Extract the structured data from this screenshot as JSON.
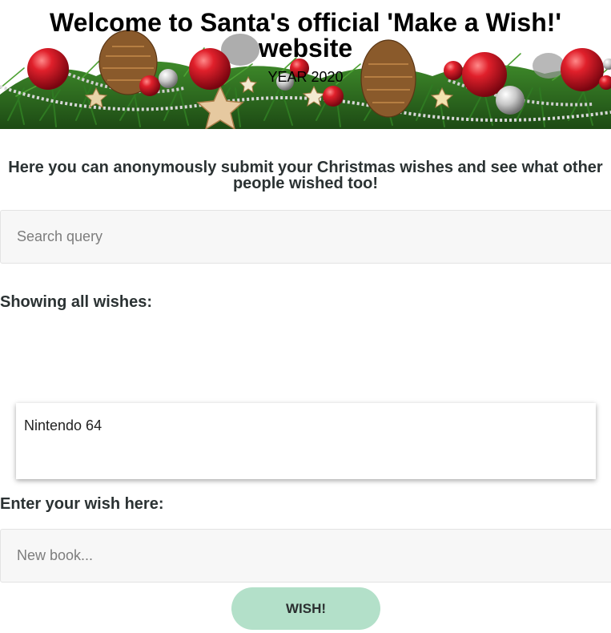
{
  "header": {
    "title": "Welcome to Santa's official 'Make a Wish!' website",
    "subtitle": "YEAR 2020"
  },
  "intro": {
    "text": "Here you can anonymously submit your Christmas wishes and see what other people wished too!"
  },
  "search": {
    "placeholder": "Search query",
    "value": ""
  },
  "wishes": {
    "heading": "Showing all wishes:",
    "items": [
      "Nintendo 64"
    ]
  },
  "new_wish": {
    "heading": "Enter your wish here:",
    "placeholder": "New book...",
    "value": "",
    "button_label": "WISH!"
  },
  "colors": {
    "button_bg": "#b3e0c9",
    "input_bg": "#f7f7f7",
    "heading_text": "#2b3233",
    "ornament_red": "#c8102e",
    "pine_green": "#2f6b1f"
  }
}
